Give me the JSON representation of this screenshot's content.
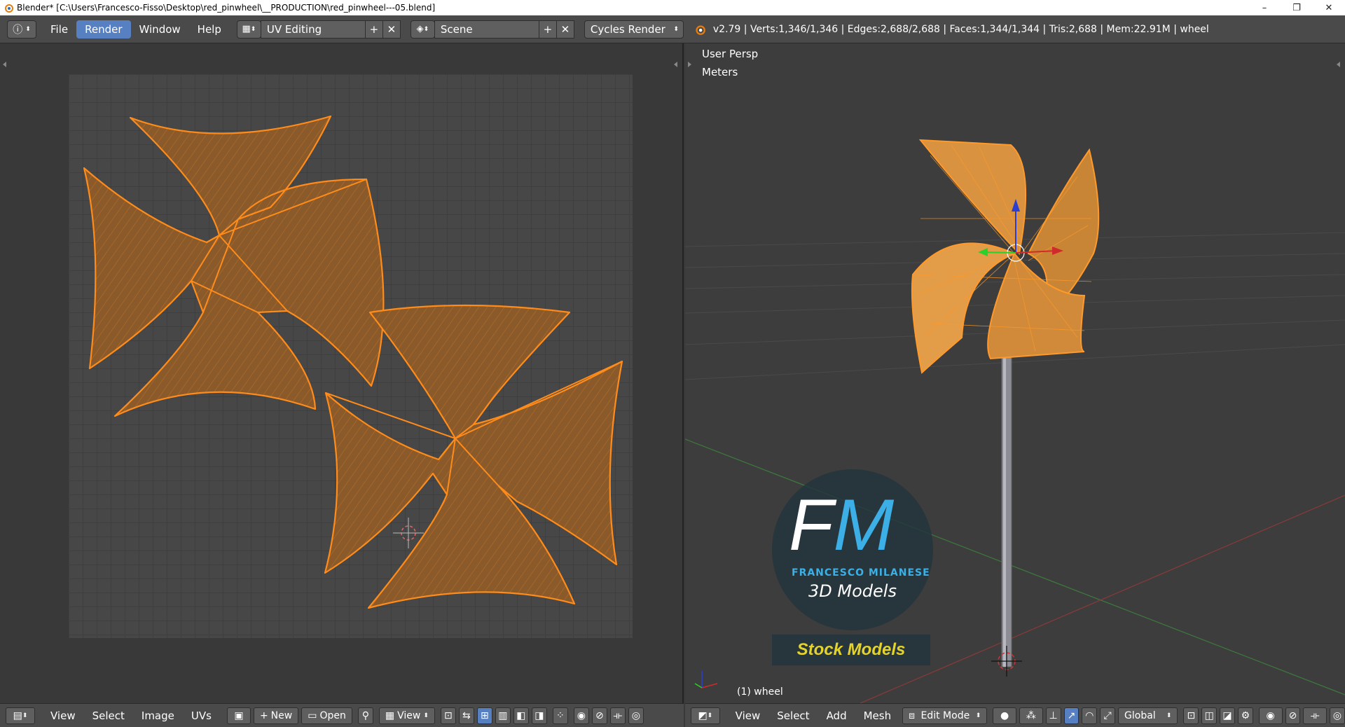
{
  "window": {
    "title": "Blender* [C:\\Users\\Francesco-Fisso\\Desktop\\red_pinwheel\\__PRODUCTION\\red_pinwheel---05.blend]",
    "minimize": "–",
    "maximize": "❐",
    "close": "✕"
  },
  "topbar": {
    "menus": [
      "File",
      "Render",
      "Window",
      "Help"
    ],
    "active_menu": "Render",
    "screen_layout": "UV Editing",
    "scene": "Scene",
    "render_engine": "Cycles Render",
    "stats": "v2.79 | Verts:1,346/1,346 | Edges:2,688/2,688 | Faces:1,344/1,344 | Tris:2,688 | Mem:22.91M | wheel"
  },
  "viewport": {
    "view_label": "User Persp",
    "units_label": "Meters",
    "object_label": "(1) wheel"
  },
  "watermark": {
    "f": "F",
    "m": "M",
    "name": "FRANCESCO MILANESE",
    "subtitle": "3D Models",
    "stock": "Stock Models"
  },
  "uv_bottom": {
    "menus": [
      "View",
      "Select",
      "Image",
      "UVs"
    ],
    "new_label": "New",
    "open_label": "Open",
    "view_label": "View"
  },
  "vp_bottom": {
    "menus": [
      "View",
      "Select",
      "Add",
      "Mesh"
    ],
    "mode": "Edit Mode",
    "orientation": "Global"
  },
  "colors": {
    "accent": "#5680c2",
    "uv_fill": "#8a5a2b",
    "uv_edge": "#ff8c1a",
    "mesh_fill": "#d9923f",
    "watermark_blue": "#3cb0e6",
    "watermark_yellow": "#e4d32c"
  }
}
